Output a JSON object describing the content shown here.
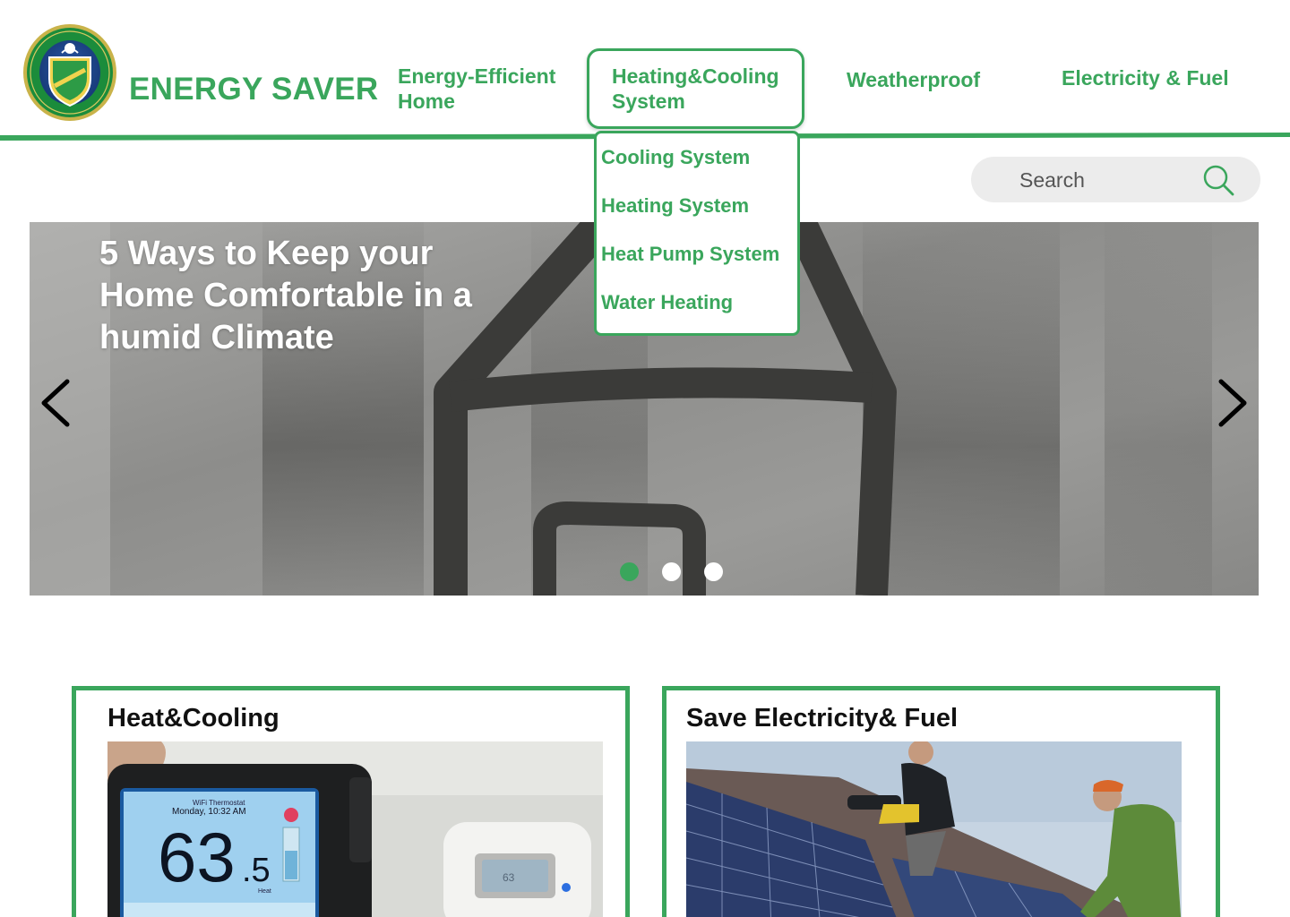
{
  "brand": {
    "title": "ENERGY SAVER",
    "accent_color": "#3aa65c"
  },
  "nav": {
    "items": [
      {
        "label": "Energy-Efficient Home"
      },
      {
        "label": "Heating&Cooling System"
      },
      {
        "label": "Weatherproof"
      },
      {
        "label": "Electricity & Fuel"
      }
    ],
    "active_item": "Heating&Cooling System"
  },
  "dropdown": {
    "items": [
      {
        "label": "Cooling System"
      },
      {
        "label": "Heating System"
      },
      {
        "label": "Heat Pump System"
      },
      {
        "label": "Water Heating"
      }
    ]
  },
  "search": {
    "placeholder": "Search",
    "icon": "search-icon"
  },
  "hero": {
    "title": "5 Ways to Keep your Home Comfortable in a humid Climate",
    "slide_count": 3,
    "active_slide": 1,
    "prev_icon": "chevron-left-icon",
    "next_icon": "chevron-right-icon"
  },
  "cards": [
    {
      "title": "Heat&Cooling"
    },
    {
      "title": "Save Electricity& Fuel"
    }
  ],
  "thermostat": {
    "label": "WiFi Thermostat",
    "time": "Monday, 10:32 AM",
    "temp_main": "63",
    "temp_decimal": ".5",
    "mode": "Heat",
    "secondary_display": "63"
  }
}
